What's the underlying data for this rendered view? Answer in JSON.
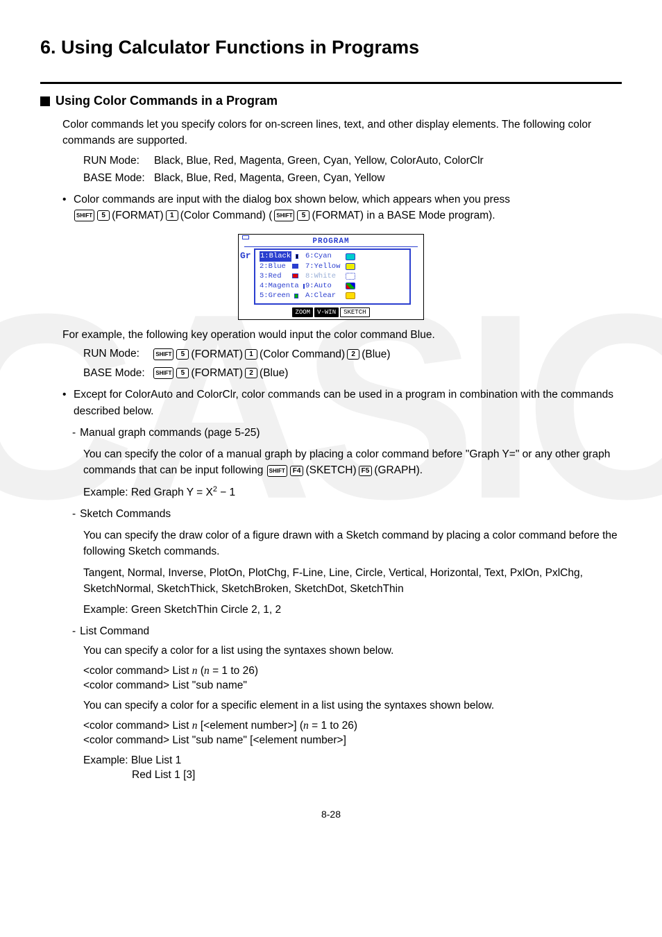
{
  "watermark": "CASIO",
  "title": "6. Using Calculator Functions in Programs",
  "section": {
    "heading": "Using Color Commands in a Program",
    "intro": "Color commands let you specify colors for on-screen lines, text, and other display elements. The following color commands are supported.",
    "modes": {
      "run_label": "RUN Mode:",
      "run_vals": "Black, Blue, Red, Magenta, Green, Cyan, Yellow, ColorAuto, ColorClr",
      "base_label": "BASE Mode:",
      "base_vals": "Black, Blue, Red, Magenta, Green, Cyan, Yellow"
    },
    "bullet1_pre": "Color commands are input with the dialog box shown below, which appears when you press",
    "bullet1_post": "(FORMAT) in a BASE Mode program).",
    "bullet1_mid_a": "(FORMAT)",
    "bullet1_mid_b": "(Color Command) (",
    "for_example": "For example, the following key operation would input the color command Blue.",
    "ex_run_label": "RUN Mode:",
    "ex_run_a": "(FORMAT)",
    "ex_run_b": "(Color Command)",
    "ex_run_c": "(Blue)",
    "ex_base_label": "BASE Mode:",
    "ex_base_a": "(FORMAT)",
    "ex_base_b": "(Blue)",
    "bullet2": "Except for ColorAuto and ColorClr, color commands can be used in a program in combination with the commands described below.",
    "manual_graph": {
      "heading": "Manual graph commands (page 5-25)",
      "body": "You can specify the color of a manual graph by placing a color command before \"Graph Y=\" or any other graph commands that can be input following",
      "sketch": "(SKETCH)",
      "graph": "(GRAPH).",
      "example_prefix": "Example: Red Graph Y = X",
      "example_suffix": " − 1"
    },
    "sketch_cmds": {
      "heading": "Sketch Commands",
      "body1": "You can specify the draw color of a figure drawn with a Sketch command by placing a color command before the following Sketch commands.",
      "list": "Tangent, Normal, Inverse, PlotOn, PlotChg, F-Line, Line, Circle, Vertical, Horizontal, Text, PxlOn, PxlChg, SketchNormal, SketchThick, SketchBroken, SketchDot, SketchThin",
      "example": "Example: Green SketchThin Circle 2, 1, 2"
    },
    "list_cmd": {
      "heading": "List Command",
      "body1": "You can specify a color for a list using the syntaxes shown below.",
      "syntax1_a": "<color command> List ",
      "syntax1_b": " (",
      "syntax1_c": " = 1 to 26)",
      "syntax2": "<color command> List \"sub name\"",
      "body2": "You can specify a color for a specific element in a list using the syntaxes shown below.",
      "syntax3_a": "<color command> List ",
      "syntax3_b": " [<element number>] (",
      "syntax3_c": " = 1 to 26)",
      "syntax4": "<color command> List \"sub name\" [<element number>]",
      "example1": "Example: Blue List 1",
      "example2": "Red List 1 [3]"
    }
  },
  "keys": {
    "shift": "SHIFT",
    "k5": "5",
    "k1": "1",
    "k2": "2",
    "f4": "F4",
    "f5": "F5"
  },
  "calc": {
    "title": "PROGRAM",
    "gr": "Gr",
    "left": [
      "1:Black",
      "2:Blue",
      "3:Red",
      "4:Magenta",
      "5:Green"
    ],
    "right": [
      "6:Cyan",
      "7:Yellow",
      "8:White",
      "9:Auto",
      "A:Clear"
    ],
    "fkeys": [
      "ZOOM",
      "V-WIN",
      "SKETCH"
    ]
  },
  "page": "8-28"
}
